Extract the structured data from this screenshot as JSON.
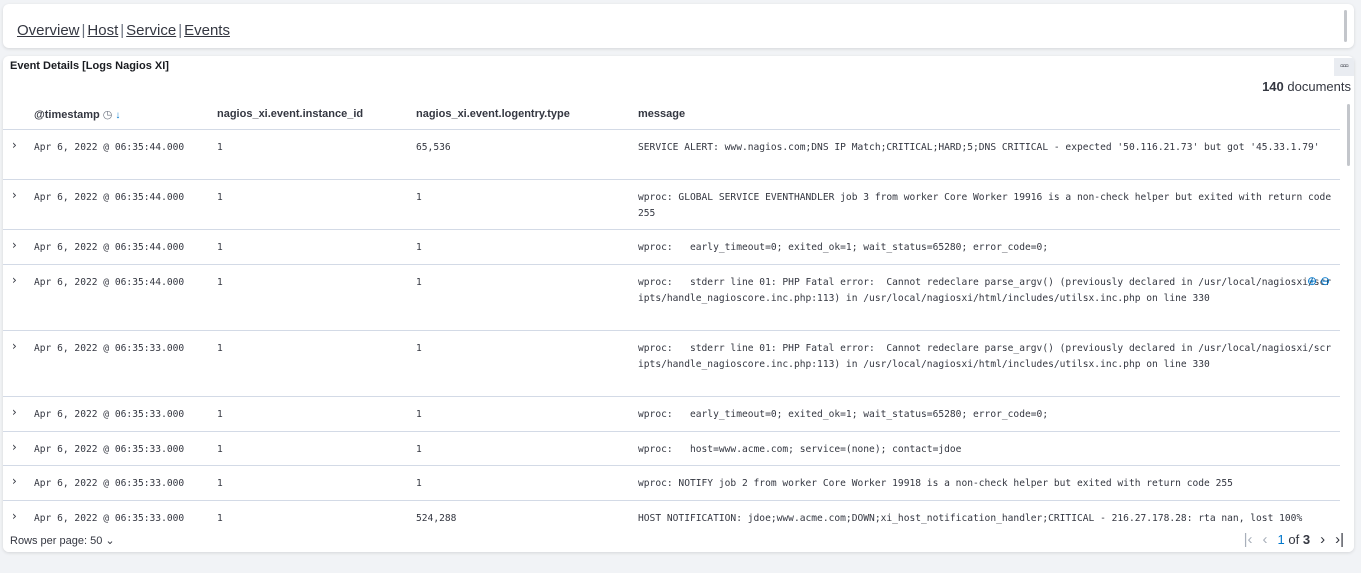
{
  "nav": {
    "links": [
      "Overview",
      "Host",
      "Service",
      "Events"
    ],
    "separator": "|"
  },
  "panel": {
    "title": "Event Details [Logs Nagios XI]",
    "menu_icon": "options-icon",
    "doc_count_value": "140",
    "doc_count_label": "documents"
  },
  "table": {
    "columns": [
      "@timestamp",
      "nagios_xi.event.instance_id",
      "nagios_xi.event.logentry.type",
      "message"
    ],
    "rows": [
      {
        "ts": "Apr 6, 2022 @ 06:35:44.000",
        "id": "1",
        "type": "65,536",
        "msg": "SERVICE ALERT: www.nagios.com;DNS IP Match;CRITICAL;HARD;5;DNS CRITICAL - expected '50.116.21.73' but got '45.33.1.79'"
      },
      {
        "ts": "Apr 6, 2022 @ 06:35:44.000",
        "id": "1",
        "type": "1",
        "msg": "wproc: GLOBAL SERVICE EVENTHANDLER job 3 from worker Core Worker 19916 is a non-check helper but exited with return code 255"
      },
      {
        "ts": "Apr 6, 2022 @ 06:35:44.000",
        "id": "1",
        "type": "1",
        "msg": "wproc:   early_timeout=0; exited_ok=1; wait_status=65280; error_code=0;"
      },
      {
        "ts": "Apr 6, 2022 @ 06:35:44.000",
        "id": "1",
        "type": "1",
        "msg": "wproc:   stderr line 01: PHP Fatal error:  Cannot redeclare parse_argv() (previously declared in /usr/local/nagiosxi/scripts/handle_nagioscore.inc.php:113) in /usr/local/nagiosxi/html/includes/utilsx.inc.php on line 330"
      },
      {
        "ts": "Apr 6, 2022 @ 06:35:33.000",
        "id": "1",
        "type": "1",
        "msg": "wproc:   stderr line 01: PHP Fatal error:  Cannot redeclare parse_argv() (previously declared in /usr/local/nagiosxi/scripts/handle_nagioscore.inc.php:113) in /usr/local/nagiosxi/html/includes/utilsx.inc.php on line 330"
      },
      {
        "ts": "Apr 6, 2022 @ 06:35:33.000",
        "id": "1",
        "type": "1",
        "msg": "wproc:   early_timeout=0; exited_ok=1; wait_status=65280; error_code=0;"
      },
      {
        "ts": "Apr 6, 2022 @ 06:35:33.000",
        "id": "1",
        "type": "1",
        "msg": "wproc:   host=www.acme.com; service=(none); contact=jdoe"
      },
      {
        "ts": "Apr 6, 2022 @ 06:35:33.000",
        "id": "1",
        "type": "1",
        "msg": "wproc: NOTIFY job 2 from worker Core Worker 19918 is a non-check helper but exited with return code 255"
      },
      {
        "ts": "Apr 6, 2022 @ 06:35:33.000",
        "id": "1",
        "type": "524,288",
        "msg": "HOST NOTIFICATION: jdoe;www.acme.com;DOWN;xi_host_notification_handler;CRITICAL - 216.27.178.28: rta nan, lost 100%"
      }
    ]
  },
  "footer": {
    "rows_per_page_label": "Rows per page: 50",
    "current_page": "1",
    "of_label": "of",
    "total_pages": "3"
  },
  "colors": {
    "accent": "#0077cc",
    "text": "#343741",
    "border": "#d3dae6"
  }
}
